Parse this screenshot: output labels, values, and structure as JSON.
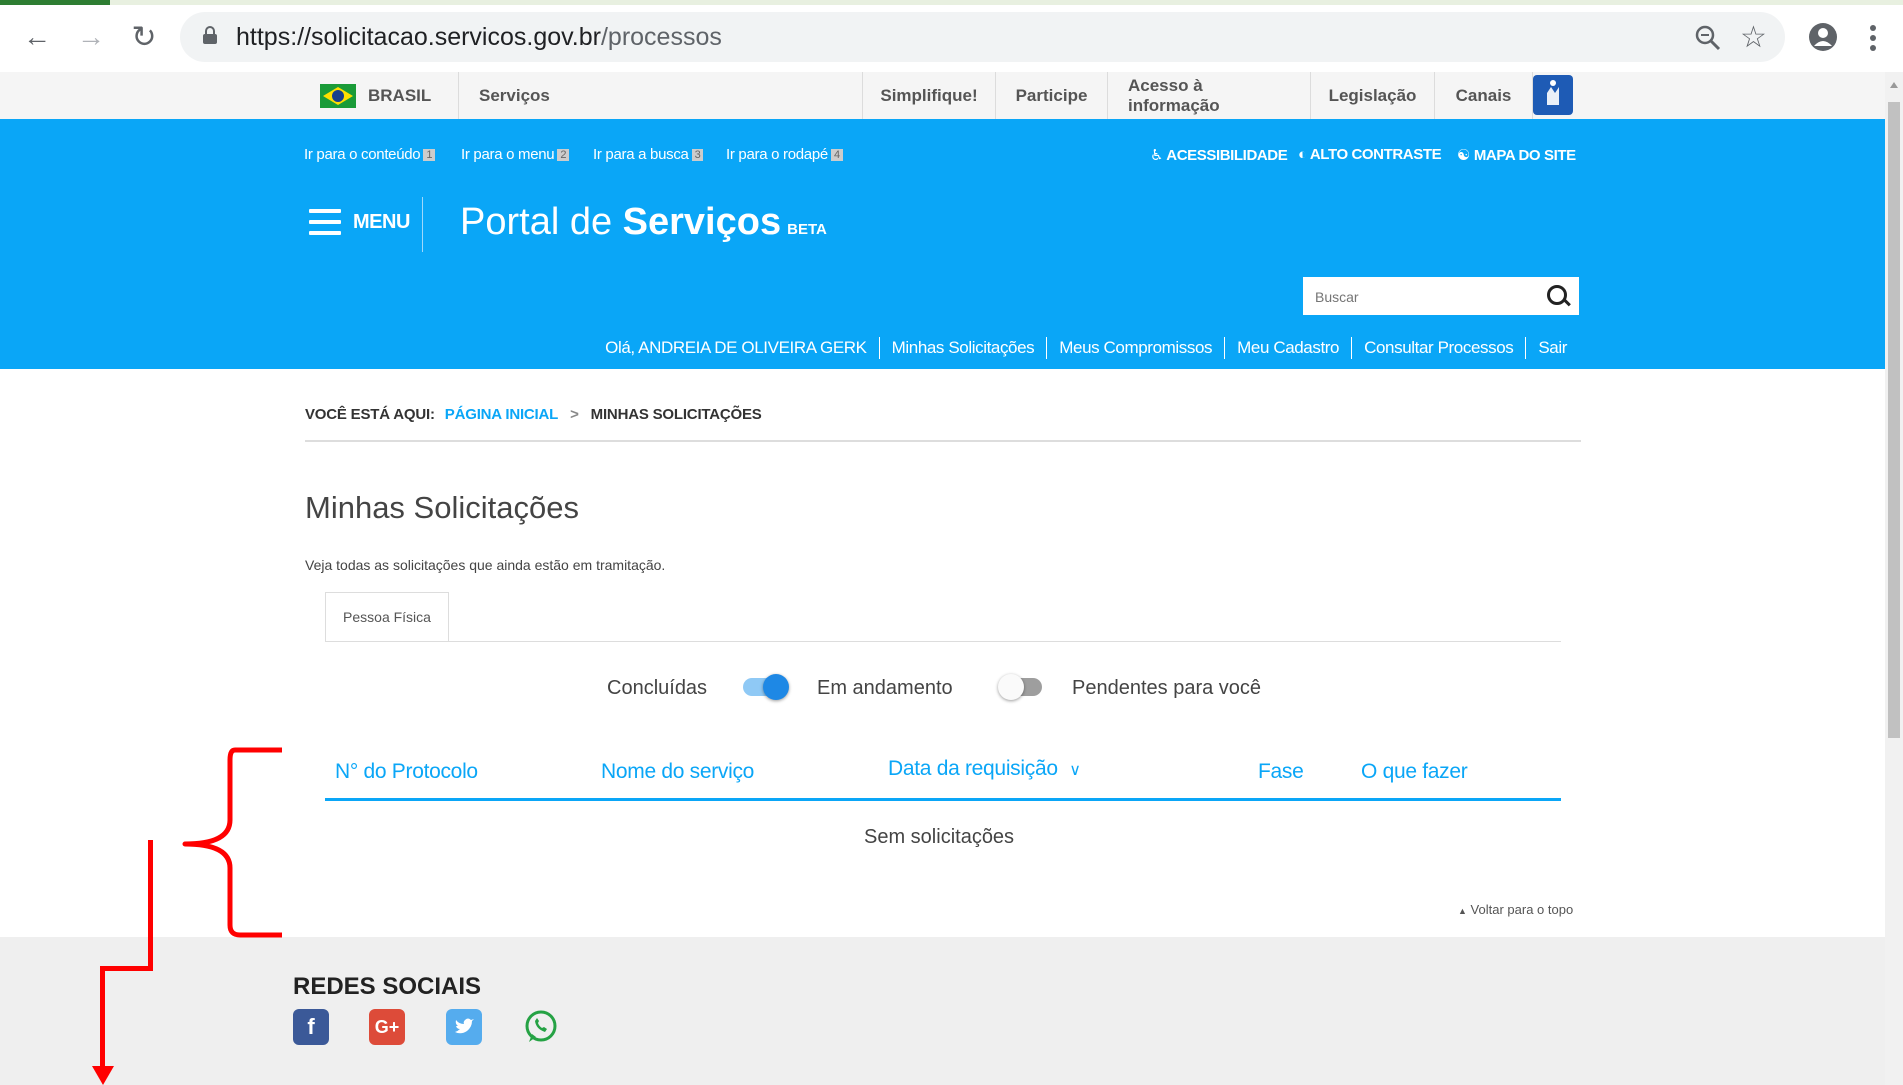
{
  "browser": {
    "url_host": "https://solicitacao.servicos.gov.br",
    "url_path": "/processos",
    "back_icon": "arrow-left-icon",
    "forward_icon": "arrow-right-icon",
    "reload_icon": "reload-icon"
  },
  "govbar": {
    "brasil": "BRASIL",
    "servicos": "Serviços",
    "items": [
      "Simplifique!",
      "Participe",
      "Acesso à informação",
      "Legislação",
      "Canais"
    ]
  },
  "header": {
    "skip_links": [
      {
        "label": "Ir para o conteúdo",
        "num": "1"
      },
      {
        "label": "Ir para o menu",
        "num": "2"
      },
      {
        "label": "Ir para a busca",
        "num": "3"
      },
      {
        "label": "Ir para o rodapé",
        "num": "4"
      }
    ],
    "tools": [
      "ACESSIBILIDADE",
      "ALTO CONTRASTE",
      "MAPA DO SITE"
    ],
    "menu_label": "MENU",
    "portal_prefix": "Portal de",
    "portal_bold": "Serviços",
    "portal_beta": "BETA",
    "search_placeholder": "Buscar",
    "user_nav": [
      "Olá, ANDREIA DE OLIVEIRA GERK",
      "Minhas Solicitações",
      "Meus Compromissos",
      "Meu Cadastro",
      "Consultar Processos",
      "Sair"
    ]
  },
  "breadcrumb": {
    "prefix": "VOCÊ ESTÁ AQUI:",
    "home": "PÁGINA INICIAL",
    "current": "MINHAS SOLICITAÇÕES"
  },
  "main": {
    "title": "Minhas Solicitações",
    "description": "Veja todas as solicitações que ainda estão em tramitação.",
    "tab": "Pessoa Física",
    "toggles": {
      "concluidas": "Concluídas",
      "em_andamento": "Em andamento",
      "pendentes": "Pendentes para você"
    },
    "columns": [
      "N° do Protocolo",
      "Nome do serviço",
      "Data da requisição",
      "Fase",
      "O que fazer"
    ],
    "empty": "Sem solicitações",
    "back_to_top": "Voltar para o topo"
  },
  "footer": {
    "redes": "REDES SOCIAIS",
    "social_icons": [
      "facebook-icon",
      "google-plus-icon",
      "twitter-icon",
      "whatsapp-icon"
    ]
  },
  "colors": {
    "header_blue": "#0aa6f7",
    "annotation_red": "#ff0000"
  }
}
